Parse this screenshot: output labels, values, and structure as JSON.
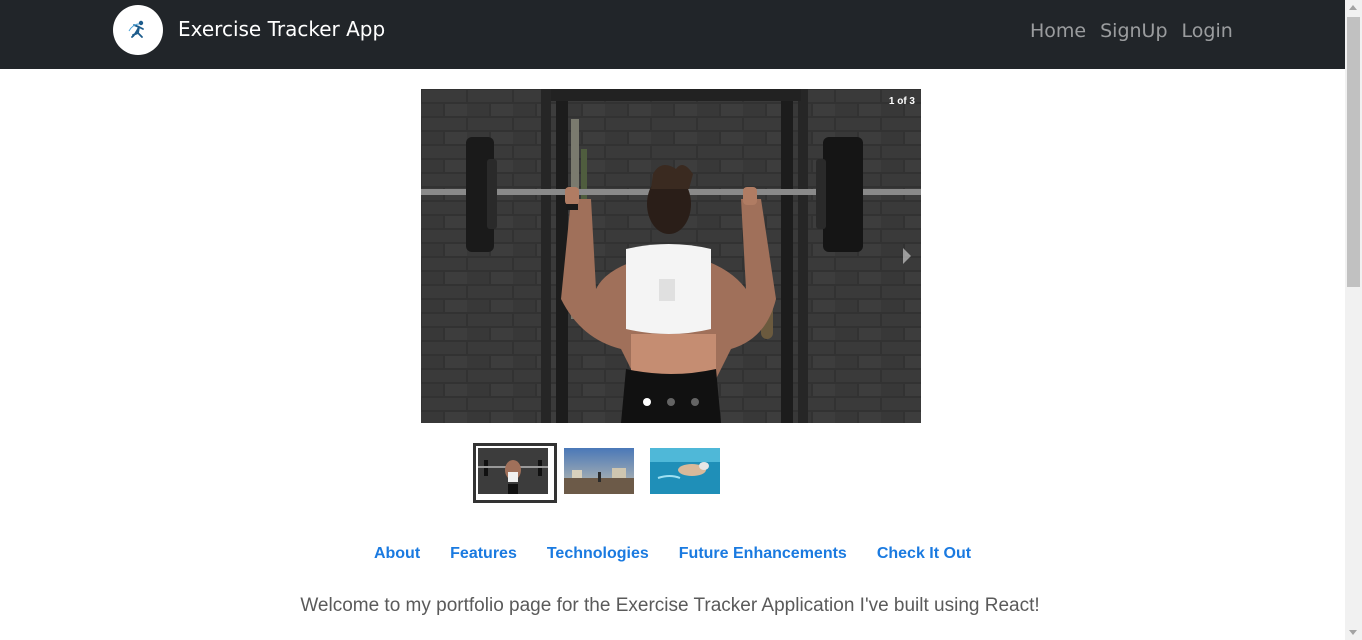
{
  "navbar": {
    "title": "Exercise Tracker App",
    "links": [
      "Home",
      "SignUp",
      "Login"
    ],
    "background": "#212529"
  },
  "carousel": {
    "counter": "1 of 3",
    "active_index": 0,
    "slide_count": 3
  },
  "sections": {
    "links": [
      "About",
      "Features",
      "Technologies",
      "Future Enhancements",
      "Check It Out"
    ],
    "link_color": "#1a7ae0"
  },
  "welcome_text": "Welcome to my portfolio page for the Exercise Tracker Application I've built using React!"
}
